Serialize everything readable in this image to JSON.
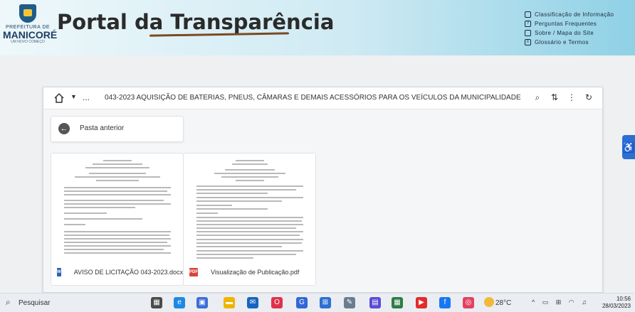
{
  "header": {
    "logo": {
      "line1": "PREFEITURA DE",
      "line2": "MANICORÉ",
      "line3": "UM NOVO COMEÇO"
    },
    "title": "Portal da Transparência",
    "links": [
      {
        "label": "Classificação de Informação",
        "icon": "building-icon"
      },
      {
        "label": "Perguntas Frequentes",
        "icon": "question-icon"
      },
      {
        "label": "Sobre / Mapa do Site",
        "icon": "sitemap-icon"
      },
      {
        "label": "Glossário e Termos",
        "icon": "list-icon"
      }
    ]
  },
  "toolbar": {
    "dots": "...",
    "path": "043-2023 AQUISIÇÃO DE BATERIAS, PNEUS, CÂMARAS E DEMAIS ACESSÓRIOS PARA OS VEÍCULOS DA MUNICIPALIDADE"
  },
  "back_button": {
    "label": "Pasta anterior"
  },
  "files": [
    {
      "name": "AVISO DE LICITAÇÃO 043-2023.docx",
      "type": "W"
    },
    {
      "name": "Visualização de Publicação.pdf",
      "type": "PDF"
    }
  ],
  "taskbar": {
    "search": "Pesquisar",
    "weather": "28°C",
    "time": "10:56",
    "date": "28/03/2023"
  }
}
